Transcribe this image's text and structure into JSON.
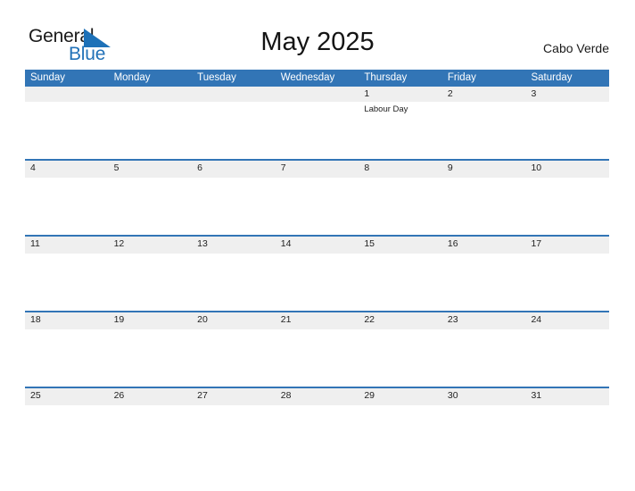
{
  "brand": {
    "name_part1": "General",
    "name_part2": "Blue",
    "triangle_icon": "triangle-icon",
    "color_blue": "#2272b8",
    "color_dark": "#1a1a1a"
  },
  "header": {
    "title": "May 2025",
    "region": "Cabo Verde"
  },
  "theme": {
    "header_blue": "#3275b6",
    "date_band_gray": "#efefef",
    "text_dark": "#222222",
    "page_background": "#ffffff"
  },
  "calendar": {
    "month": "May",
    "year": "2025",
    "weekdays": [
      "Sunday",
      "Monday",
      "Tuesday",
      "Wednesday",
      "Thursday",
      "Friday",
      "Saturday"
    ],
    "weeks": [
      {
        "rule": false,
        "days": [
          {
            "num": "",
            "events": []
          },
          {
            "num": "",
            "events": []
          },
          {
            "num": "",
            "events": []
          },
          {
            "num": "",
            "events": []
          },
          {
            "num": "1",
            "events": [
              "Labour Day"
            ]
          },
          {
            "num": "2",
            "events": []
          },
          {
            "num": "3",
            "events": []
          }
        ]
      },
      {
        "rule": true,
        "days": [
          {
            "num": "4",
            "events": []
          },
          {
            "num": "5",
            "events": []
          },
          {
            "num": "6",
            "events": []
          },
          {
            "num": "7",
            "events": []
          },
          {
            "num": "8",
            "events": []
          },
          {
            "num": "9",
            "events": []
          },
          {
            "num": "10",
            "events": []
          }
        ]
      },
      {
        "rule": true,
        "days": [
          {
            "num": "11",
            "events": []
          },
          {
            "num": "12",
            "events": []
          },
          {
            "num": "13",
            "events": []
          },
          {
            "num": "14",
            "events": []
          },
          {
            "num": "15",
            "events": []
          },
          {
            "num": "16",
            "events": []
          },
          {
            "num": "17",
            "events": []
          }
        ]
      },
      {
        "rule": true,
        "days": [
          {
            "num": "18",
            "events": []
          },
          {
            "num": "19",
            "events": []
          },
          {
            "num": "20",
            "events": []
          },
          {
            "num": "21",
            "events": []
          },
          {
            "num": "22",
            "events": []
          },
          {
            "num": "23",
            "events": []
          },
          {
            "num": "24",
            "events": []
          }
        ]
      },
      {
        "rule": true,
        "days": [
          {
            "num": "25",
            "events": []
          },
          {
            "num": "26",
            "events": []
          },
          {
            "num": "27",
            "events": []
          },
          {
            "num": "28",
            "events": []
          },
          {
            "num": "29",
            "events": []
          },
          {
            "num": "30",
            "events": []
          },
          {
            "num": "31",
            "events": []
          }
        ]
      }
    ]
  }
}
